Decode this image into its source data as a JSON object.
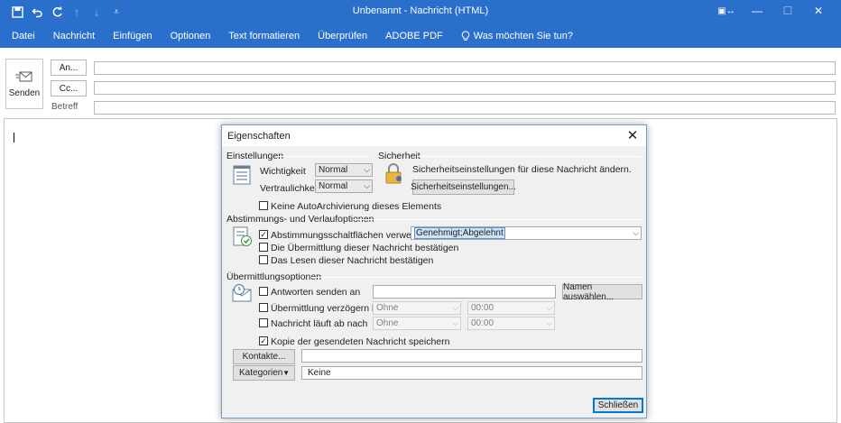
{
  "window": {
    "title": "Unbenannt - Nachricht (HTML)"
  },
  "ribbon": {
    "tabs": [
      "Datei",
      "Nachricht",
      "Einfügen",
      "Optionen",
      "Text formatieren",
      "Überprüfen",
      "ADOBE PDF"
    ],
    "tell_me": "Was möchten Sie tun?"
  },
  "compose": {
    "send_label": "Senden",
    "to_button": "An...",
    "cc_button": "Cc...",
    "subject_label": "Betreff",
    "to_value": "",
    "cc_value": "",
    "subject_value": ""
  },
  "dialog": {
    "title": "Eigenschaften",
    "close_label": "Schließen",
    "settings": {
      "heading": "Einstellungen",
      "importance_label": "Wichtigkeit",
      "importance_value": "Normal",
      "sensitivity_label": "Vertraulichkeit",
      "sensitivity_value": "Normal",
      "no_autoarchive_label": "Keine AutoArchivierung dieses Elements",
      "no_autoarchive_checked": false
    },
    "security": {
      "heading": "Sicherheit",
      "text": "Sicherheitseinstellungen für diese Nachricht ändern.",
      "button": "Sicherheitseinstellungen..."
    },
    "voting": {
      "heading": "Abstimmungs- und Verlaufoptionen",
      "use_voting_label": "Abstimmungsschaltflächen verwenden",
      "use_voting_checked": true,
      "voting_value": "Genehmigt;Abgelehnt",
      "delivery_receipt_label": "Die Übermittlung dieser Nachricht bestätigen",
      "delivery_receipt_checked": false,
      "read_receipt_label": "Das Lesen dieser Nachricht bestätigen",
      "read_receipt_checked": false
    },
    "delivery": {
      "heading": "Übermittlungsoptionen",
      "replies_label": "Antworten senden an",
      "replies_value": "",
      "select_names_button": "Namen auswählen...",
      "delay_label": "Übermittlung verzögern bis",
      "delay_date": "Ohne",
      "delay_time": "00:00",
      "expires_label": "Nachricht läuft ab nach",
      "expires_date": "Ohne",
      "expires_time": "00:00",
      "save_copy_label": "Kopie der gesendeten Nachricht speichern",
      "save_copy_checked": true,
      "contacts_button": "Kontakte...",
      "contacts_value": "",
      "categories_button": "Kategorien",
      "categories_value": "Keine"
    }
  }
}
